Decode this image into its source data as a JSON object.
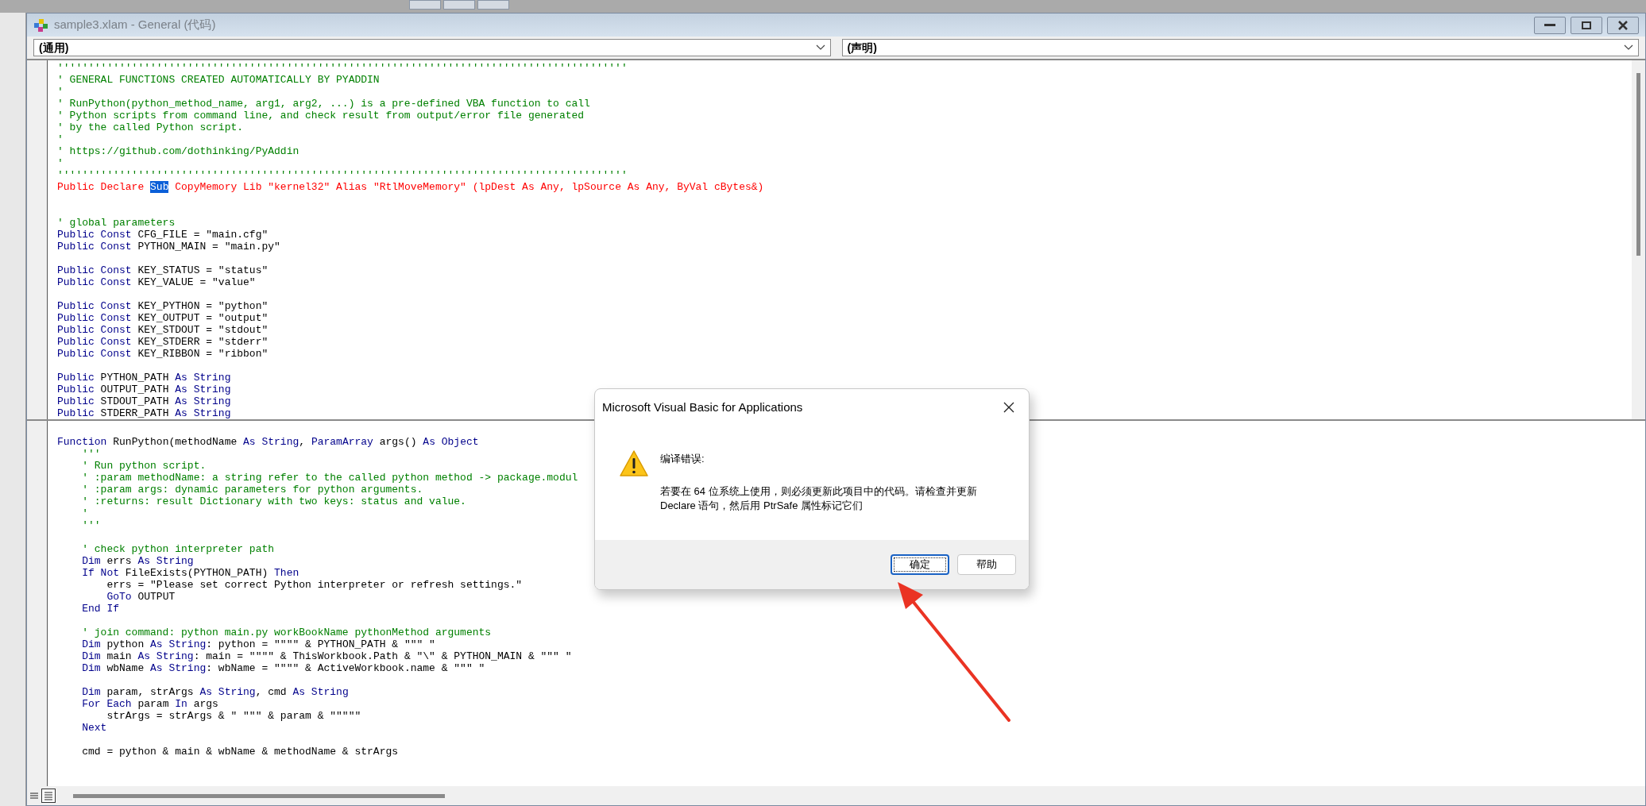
{
  "window": {
    "title": "sample3.xlam - General (代码)"
  },
  "object_dropdown": {
    "value": "(通用)"
  },
  "procedure_dropdown": {
    "value": "(声明)"
  },
  "code_top": [
    {
      "kind": "code",
      "tokens": [
        {
          "kind": "comment",
          "text": "''''''''''''''''''''''''''''''''''''''''''''''''''''''''''''''''''''''''''''''''''''''''''''"
        }
      ]
    },
    {
      "kind": "code",
      "tokens": [
        {
          "kind": "comment",
          "text": "' GENERAL FUNCTIONS CREATED AUTOMATICALLY BY PYADDIN"
        }
      ]
    },
    {
      "kind": "code",
      "tokens": [
        {
          "kind": "comment",
          "text": "'"
        }
      ]
    },
    {
      "kind": "code",
      "tokens": [
        {
          "kind": "comment",
          "text": "' RunPython(python_method_name, arg1, arg2, ...) is a pre-defined VBA function to call"
        }
      ]
    },
    {
      "kind": "code",
      "tokens": [
        {
          "kind": "comment",
          "text": "' Python scripts from command line, and check result from output/error file generated"
        }
      ]
    },
    {
      "kind": "code",
      "tokens": [
        {
          "kind": "comment",
          "text": "' by the called Python script."
        }
      ]
    },
    {
      "kind": "code",
      "tokens": [
        {
          "kind": "comment",
          "text": "'"
        }
      ]
    },
    {
      "kind": "code",
      "tokens": [
        {
          "kind": "comment",
          "text": "' https://github.com/dothinking/PyAddin"
        }
      ]
    },
    {
      "kind": "code",
      "tokens": [
        {
          "kind": "comment",
          "text": "'"
        }
      ]
    },
    {
      "kind": "code",
      "tokens": [
        {
          "kind": "comment",
          "text": "''''''''''''''''''''''''''''''''''''''''''''''''''''''''''''''''''''''''''''''''''''''''''''"
        }
      ]
    },
    {
      "kind": "code",
      "tokens": [
        {
          "kind": "error",
          "text": "Public Declare "
        },
        {
          "kind": "selected",
          "text": "Sub"
        },
        {
          "kind": "error",
          "text": " CopyMemory Lib \"kernel32\" Alias \"RtlMoveMemory\" (lpDest As Any, lpSource As Any, ByVal cBytes&)"
        }
      ]
    },
    {
      "kind": "blank"
    },
    {
      "kind": "blank"
    },
    {
      "kind": "code",
      "tokens": [
        {
          "kind": "comment",
          "text": "' global parameters"
        }
      ]
    },
    {
      "kind": "code",
      "tokens": [
        {
          "kind": "keyword",
          "text": "Public Const"
        },
        {
          "kind": "text",
          "text": " CFG_FILE = \"main.cfg\""
        }
      ]
    },
    {
      "kind": "code",
      "tokens": [
        {
          "kind": "keyword",
          "text": "Public Const"
        },
        {
          "kind": "text",
          "text": " PYTHON_MAIN = \"main.py\""
        }
      ]
    },
    {
      "kind": "blank"
    },
    {
      "kind": "code",
      "tokens": [
        {
          "kind": "keyword",
          "text": "Public Const"
        },
        {
          "kind": "text",
          "text": " KEY_STATUS = \"status\""
        }
      ]
    },
    {
      "kind": "code",
      "tokens": [
        {
          "kind": "keyword",
          "text": "Public Const"
        },
        {
          "kind": "text",
          "text": " KEY_VALUE = \"value\""
        }
      ]
    },
    {
      "kind": "blank"
    },
    {
      "kind": "code",
      "tokens": [
        {
          "kind": "keyword",
          "text": "Public Const"
        },
        {
          "kind": "text",
          "text": " KEY_PYTHON = \"python\""
        }
      ]
    },
    {
      "kind": "code",
      "tokens": [
        {
          "kind": "keyword",
          "text": "Public Const"
        },
        {
          "kind": "text",
          "text": " KEY_OUTPUT = \"output\""
        }
      ]
    },
    {
      "kind": "code",
      "tokens": [
        {
          "kind": "keyword",
          "text": "Public Const"
        },
        {
          "kind": "text",
          "text": " KEY_STDOUT = \"stdout\""
        }
      ]
    },
    {
      "kind": "code",
      "tokens": [
        {
          "kind": "keyword",
          "text": "Public Const"
        },
        {
          "kind": "text",
          "text": " KEY_STDERR = \"stderr\""
        }
      ]
    },
    {
      "kind": "code",
      "tokens": [
        {
          "kind": "keyword",
          "text": "Public Const"
        },
        {
          "kind": "text",
          "text": " KEY_RIBBON = \"ribbon\""
        }
      ]
    },
    {
      "kind": "blank"
    },
    {
      "kind": "code",
      "tokens": [
        {
          "kind": "keyword",
          "text": "Public"
        },
        {
          "kind": "text",
          "text": " PYTHON_PATH "
        },
        {
          "kind": "keyword",
          "text": "As String"
        }
      ]
    },
    {
      "kind": "code",
      "tokens": [
        {
          "kind": "keyword",
          "text": "Public"
        },
        {
          "kind": "text",
          "text": " OUTPUT_PATH "
        },
        {
          "kind": "keyword",
          "text": "As String"
        }
      ]
    },
    {
      "kind": "code",
      "tokens": [
        {
          "kind": "keyword",
          "text": "Public"
        },
        {
          "kind": "text",
          "text": " STDOUT_PATH "
        },
        {
          "kind": "keyword",
          "text": "As String"
        }
      ]
    },
    {
      "kind": "code",
      "tokens": [
        {
          "kind": "keyword",
          "text": "Public"
        },
        {
          "kind": "text",
          "text": " STDERR_PATH "
        },
        {
          "kind": "keyword",
          "text": "As String"
        }
      ]
    }
  ],
  "code_bottom": [
    {
      "kind": "blank"
    },
    {
      "kind": "code",
      "tokens": [
        {
          "kind": "keyword",
          "text": "Function"
        },
        {
          "kind": "text",
          "text": " RunPython(methodName "
        },
        {
          "kind": "keyword",
          "text": "As String"
        },
        {
          "kind": "text",
          "text": ", "
        },
        {
          "kind": "keyword",
          "text": "ParamArray"
        },
        {
          "kind": "text",
          "text": " args() "
        },
        {
          "kind": "keyword",
          "text": "As Object"
        }
      ]
    },
    {
      "kind": "code",
      "tokens": [
        {
          "kind": "comment",
          "text": "    '''"
        }
      ]
    },
    {
      "kind": "code",
      "tokens": [
        {
          "kind": "comment",
          "text": "    ' Run python script."
        }
      ]
    },
    {
      "kind": "code",
      "tokens": [
        {
          "kind": "comment",
          "text": "    ' :param methodName: a string refer to the called python method -> package.modul"
        }
      ]
    },
    {
      "kind": "code",
      "tokens": [
        {
          "kind": "comment",
          "text": "    ' :param args: dynamic parameters for python arguments."
        }
      ]
    },
    {
      "kind": "code",
      "tokens": [
        {
          "kind": "comment",
          "text": "    ' :returns: result Dictionary with two keys: status and value."
        }
      ]
    },
    {
      "kind": "code",
      "tokens": [
        {
          "kind": "comment",
          "text": "    '"
        }
      ]
    },
    {
      "kind": "code",
      "tokens": [
        {
          "kind": "comment",
          "text": "    '''"
        }
      ]
    },
    {
      "kind": "blank"
    },
    {
      "kind": "code",
      "tokens": [
        {
          "kind": "comment",
          "text": "    ' check python interpreter path"
        }
      ]
    },
    {
      "kind": "code",
      "tokens": [
        {
          "kind": "keyword",
          "text": "    Dim"
        },
        {
          "kind": "text",
          "text": " errs "
        },
        {
          "kind": "keyword",
          "text": "As String"
        }
      ]
    },
    {
      "kind": "code",
      "tokens": [
        {
          "kind": "keyword",
          "text": "    If Not"
        },
        {
          "kind": "text",
          "text": " FileExists(PYTHON_PATH) "
        },
        {
          "kind": "keyword",
          "text": "Then"
        }
      ]
    },
    {
      "kind": "code",
      "tokens": [
        {
          "kind": "text",
          "text": "        errs = \"Please set correct Python interpreter or refresh settings.\""
        }
      ]
    },
    {
      "kind": "code",
      "tokens": [
        {
          "kind": "keyword",
          "text": "        GoTo"
        },
        {
          "kind": "text",
          "text": " OUTPUT"
        }
      ]
    },
    {
      "kind": "code",
      "tokens": [
        {
          "kind": "keyword",
          "text": "    End If"
        }
      ]
    },
    {
      "kind": "blank"
    },
    {
      "kind": "code",
      "tokens": [
        {
          "kind": "comment",
          "text": "    ' join command: python main.py workBookName pythonMethod arguments"
        }
      ]
    },
    {
      "kind": "code",
      "tokens": [
        {
          "kind": "keyword",
          "text": "    Dim"
        },
        {
          "kind": "text",
          "text": " python "
        },
        {
          "kind": "keyword",
          "text": "As String"
        },
        {
          "kind": "text",
          "text": ": python = \"\"\"\" & PYTHON_PATH & \"\"\" \""
        }
      ]
    },
    {
      "kind": "code",
      "tokens": [
        {
          "kind": "keyword",
          "text": "    Dim"
        },
        {
          "kind": "text",
          "text": " main "
        },
        {
          "kind": "keyword",
          "text": "As String"
        },
        {
          "kind": "text",
          "text": ": main = \"\"\"\" & ThisWorkbook.Path & \"\\\" & PYTHON_MAIN & \"\"\" \""
        }
      ]
    },
    {
      "kind": "code",
      "tokens": [
        {
          "kind": "keyword",
          "text": "    Dim"
        },
        {
          "kind": "text",
          "text": " wbName "
        },
        {
          "kind": "keyword",
          "text": "As String"
        },
        {
          "kind": "text",
          "text": ": wbName = \"\"\"\" & ActiveWorkbook.name & \"\"\" \""
        }
      ]
    },
    {
      "kind": "blank"
    },
    {
      "kind": "code",
      "tokens": [
        {
          "kind": "keyword",
          "text": "    Dim"
        },
        {
          "kind": "text",
          "text": " param, strArgs "
        },
        {
          "kind": "keyword",
          "text": "As String"
        },
        {
          "kind": "text",
          "text": ", cmd "
        },
        {
          "kind": "keyword",
          "text": "As String"
        }
      ]
    },
    {
      "kind": "code",
      "tokens": [
        {
          "kind": "keyword",
          "text": "    For Each"
        },
        {
          "kind": "text",
          "text": " param "
        },
        {
          "kind": "keyword",
          "text": "In"
        },
        {
          "kind": "text",
          "text": " args"
        }
      ]
    },
    {
      "kind": "code",
      "tokens": [
        {
          "kind": "text",
          "text": "        strArgs = strArgs & \" \"\"\" & param & \"\"\"\"\""
        }
      ]
    },
    {
      "kind": "code",
      "tokens": [
        {
          "kind": "keyword",
          "text": "    Next"
        }
      ]
    },
    {
      "kind": "blank"
    },
    {
      "kind": "code",
      "tokens": [
        {
          "kind": "text",
          "text": "    cmd = python & main & wbName & methodName & strArgs"
        }
      ]
    }
  ],
  "dialog": {
    "title": "Microsoft Visual Basic for Applications",
    "heading": "编译错误:",
    "message": "若要在 64 位系统上使用，则必须更新此项目中的代码。请检查并更新 Declare 语句，然后用 PtrSafe 属性标记它们",
    "buttons": [
      {
        "label": "确定",
        "focused": true
      },
      {
        "label": "帮助",
        "focused": false
      }
    ]
  }
}
